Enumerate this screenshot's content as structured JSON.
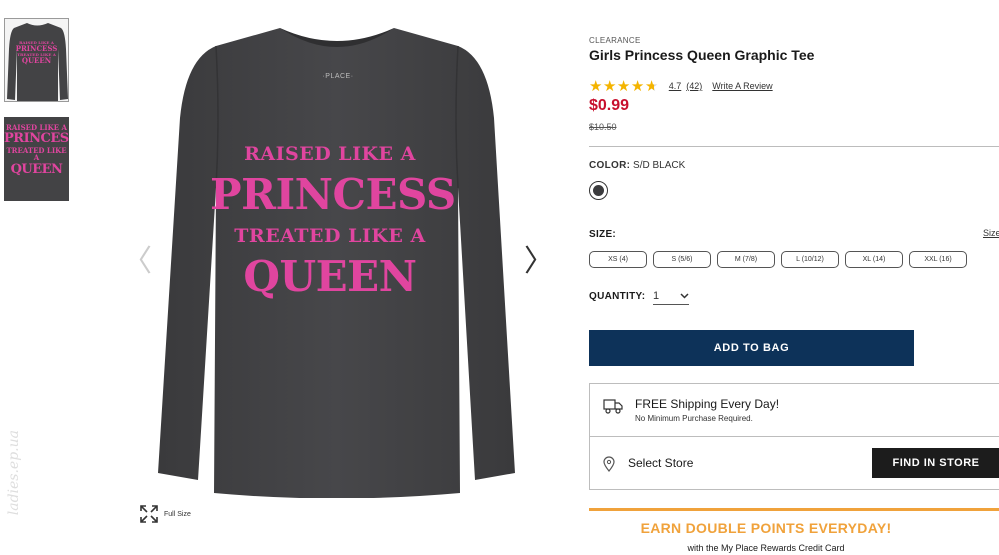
{
  "gallery": {
    "thumb1_text": [
      "RAISED LIKE A",
      "PRINCESS",
      "TREATED LIKE A",
      "QUEEN"
    ],
    "thumb2_text": [
      "RAISED LIKE A",
      "PRINCESS",
      "TREATED LIKE A",
      "QUEEN"
    ],
    "neck_label": "·PLACE·",
    "graphic": {
      "line1": "RAISED LIKE A",
      "line2": "PRINCESS",
      "line3": "TREATED LIKE A",
      "line4": "QUEEN"
    },
    "prev_arrow": "〈",
    "next_arrow": "〉",
    "full_size_label": "Full Size",
    "watermark": "ladies.ep.ua"
  },
  "product": {
    "clearance": "CLEARANCE",
    "title": "Girls Princess Queen Graphic Tee",
    "rating": "4.7",
    "rating_value": 4.7,
    "review_count": "(42)",
    "write_review": "Write A Review",
    "price": "$0.99",
    "old_price": "$10.50",
    "color_label": "COLOR:",
    "color_value": "S/D BLACK",
    "swatch_color": "#3b3b3d",
    "size_label": "SIZE:",
    "size_guide": "Size",
    "sizes": [
      "XS (4)",
      "S (5/6)",
      "M (7/8)",
      "L (10/12)",
      "XL (14)",
      "XXL (16)"
    ],
    "quantity_label": "QUANTITY:",
    "quantity_value": "1",
    "add_to_bag": "ADD TO BAG"
  },
  "shipping": {
    "title": "FREE Shipping Every Day!",
    "subtitle": "No Minimum Purchase Required.",
    "select_store": "Select Store",
    "find_in_store": "FIND IN STORE"
  },
  "promo": {
    "title": "EARN DOUBLE POINTS EVERYDAY!",
    "subtitle": "with the My Place Rewards Credit Card"
  },
  "colors": {
    "accent_navy": "#0d3259",
    "price_red": "#c8102e",
    "star_gold": "#f4b400",
    "promo_orange": "#f0a23b",
    "shirt_gray": "#424244",
    "graphic_pink": "#e0459f"
  }
}
